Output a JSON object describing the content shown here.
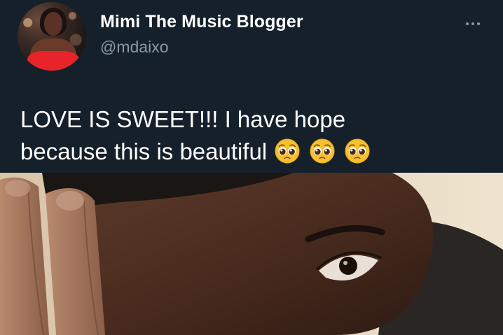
{
  "tweet": {
    "display_name": "Mimi The Music Blogger",
    "handle": "@mdaixo",
    "text_line_1": "LOVE IS SWEET!!! I have hope",
    "text_line_2": "because this is beautiful",
    "emojis": [
      "pleading-face",
      "pleading-face",
      "pleading-face"
    ],
    "more_icon": "more-horizontal-icon"
  },
  "colors": {
    "background": "#15202b",
    "primary_text": "#ffffff",
    "secondary_text": "#8b98a5"
  }
}
